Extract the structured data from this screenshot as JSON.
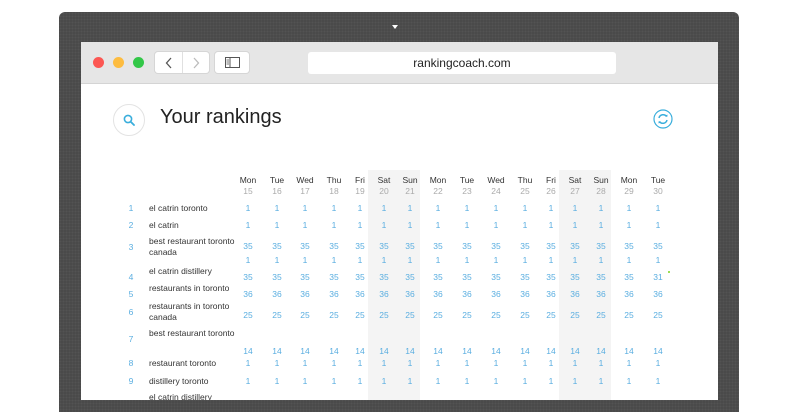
{
  "browser": {
    "url": "rankingcoach.com"
  },
  "page": {
    "title": "Your rankings"
  },
  "table": {
    "days": [
      {
        "day": "Mon",
        "date": "15"
      },
      {
        "day": "Tue",
        "date": "16"
      },
      {
        "day": "Wed",
        "date": "17"
      },
      {
        "day": "Thu",
        "date": "18"
      },
      {
        "day": "Fri",
        "date": "19"
      },
      {
        "day": "Sat",
        "date": "20"
      },
      {
        "day": "Sun",
        "date": "21"
      },
      {
        "day": "Mon",
        "date": "22"
      },
      {
        "day": "Tue",
        "date": "23"
      },
      {
        "day": "Wed",
        "date": "24"
      },
      {
        "day": "Thu",
        "date": "25"
      },
      {
        "day": "Fri",
        "date": "26"
      },
      {
        "day": "Sat",
        "date": "27"
      },
      {
        "day": "Sun",
        "date": "28"
      },
      {
        "day": "Mon",
        "date": "29"
      },
      {
        "day": "Tue",
        "date": "30"
      }
    ],
    "rows": [
      {
        "num": "1",
        "keyword": "el catrin toronto",
        "values": [
          "1",
          "1",
          "1",
          "1",
          "1",
          "1",
          "1",
          "1",
          "1",
          "1",
          "1",
          "1",
          "1",
          "1",
          "1",
          "1"
        ]
      },
      {
        "num": "2",
        "keyword": "el catrin",
        "values": [
          "1",
          "1",
          "1",
          "1",
          "1",
          "1",
          "1",
          "1",
          "1",
          "1",
          "1",
          "1",
          "1",
          "1",
          "1",
          "1"
        ]
      },
      {
        "num": "3",
        "keyword": "best restaurant toronto canada",
        "values": [
          "35",
          "35",
          "35",
          "35",
          "35",
          "35",
          "35",
          "35",
          "35",
          "35",
          "35",
          "35",
          "35",
          "35",
          "35",
          "35"
        ]
      },
      {
        "num": "",
        "keyword": "",
        "values": [
          "1",
          "1",
          "1",
          "1",
          "1",
          "1",
          "1",
          "1",
          "1",
          "1",
          "1",
          "1",
          "1",
          "1",
          "1",
          "1"
        ]
      },
      {
        "num": "4",
        "keyword": "el catrin distillery",
        "values": [
          "35",
          "35",
          "35",
          "35",
          "35",
          "35",
          "35",
          "35",
          "35",
          "35",
          "35",
          "35",
          "35",
          "35",
          "35",
          "31"
        ],
        "marker": {
          "color": "#7ed321"
        }
      },
      {
        "num": "5",
        "keyword": "restaurants in toronto",
        "values": [
          "36",
          "36",
          "36",
          "36",
          "36",
          "36",
          "36",
          "36",
          "36",
          "36",
          "36",
          "36",
          "36",
          "36",
          "36",
          "36"
        ]
      },
      {
        "num": "6",
        "keyword": "restaurants in toronto canada",
        "values": [
          "25",
          "25",
          "25",
          "25",
          "25",
          "25",
          "25",
          "25",
          "25",
          "25",
          "25",
          "25",
          "25",
          "25",
          "25",
          "25"
        ]
      },
      {
        "num": "7",
        "keyword": "best restaurant toronto",
        "values": [
          "14",
          "14",
          "14",
          "14",
          "14",
          "14",
          "14",
          "14",
          "14",
          "14",
          "14",
          "14",
          "14",
          "14",
          "14",
          "14"
        ]
      },
      {
        "num": "8",
        "keyword": "restaurant toronto",
        "values": [
          "1",
          "1",
          "1",
          "1",
          "1",
          "1",
          "1",
          "1",
          "1",
          "1",
          "1",
          "1",
          "1",
          "1",
          "1",
          "1"
        ]
      },
      {
        "num": "9",
        "keyword": "distillery toronto",
        "values": [
          "1",
          "1",
          "1",
          "1",
          "1",
          "1",
          "1",
          "1",
          "1",
          "1",
          "1",
          "1",
          "1",
          "1",
          "1",
          "1"
        ]
      },
      {
        "num": "",
        "keyword": "el catrin distillery",
        "values": []
      }
    ],
    "weekend_columns": [
      5,
      6,
      12,
      13
    ]
  },
  "colors": {
    "value": "#5aaee0",
    "accent": "#3aaedc",
    "weekend_shade": "#f4f4f4",
    "dark_gray": "#4a4a4a"
  },
  "icons": {
    "search": "search-icon",
    "refresh": "refresh-icon",
    "back": "chevron-left-icon",
    "forward": "chevron-right-icon",
    "sidebar": "sidebar-icon"
  }
}
